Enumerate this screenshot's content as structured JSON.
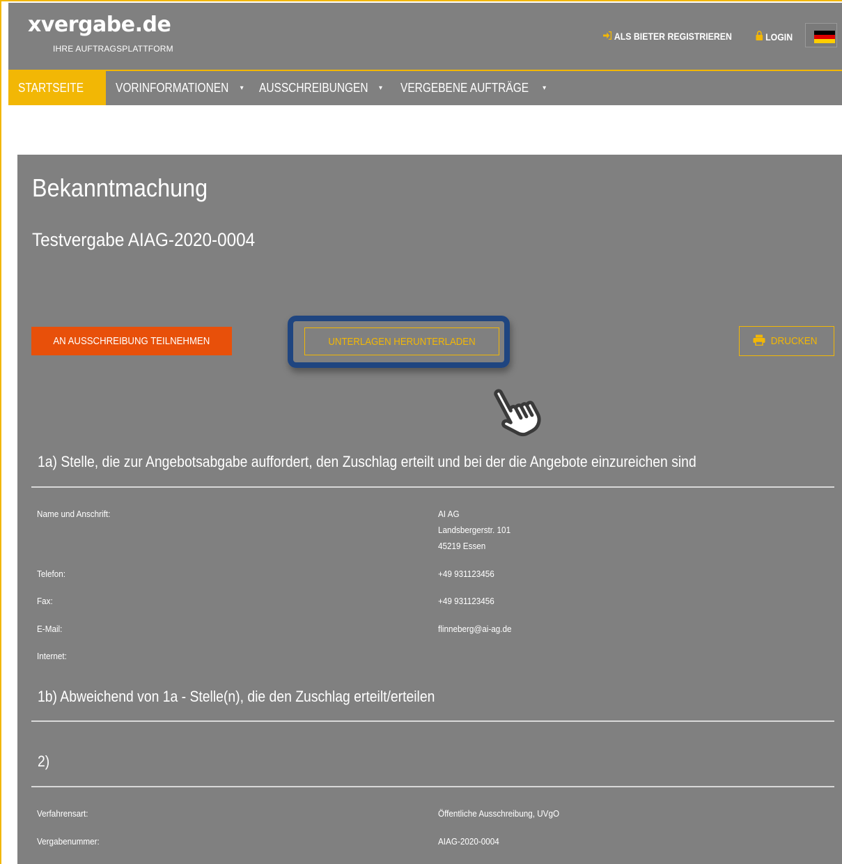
{
  "header": {
    "logo": "xvergabe.de",
    "tagline": "IHRE AUFTRAGSPLATTFORM",
    "register_label": "ALS BIETER REGISTRIEREN",
    "login_label": "LOGIN",
    "language": "de",
    "colors": {
      "accent": "#f2b705",
      "bar": "#808080"
    }
  },
  "nav": {
    "items": [
      {
        "label": "STARTSEITE",
        "active": true
      },
      {
        "label": "VORINFORMATIONEN"
      },
      {
        "label": "AUSSCHREIBUNGEN"
      },
      {
        "label": "VERGEBENE AUFTRÄGE"
      }
    ]
  },
  "main": {
    "title": "Bekanntmachung",
    "subtitle": "Testvergabe AIAG-2020-0004",
    "buttons": {
      "participate": "AN AUSSCHREIBUNG TEILNEHMEN",
      "download": "UNTERLAGEN HERUNTERLADEN",
      "print": "DRUCKEN"
    },
    "section_1a": {
      "title": "1a) Stelle, die zur Angebotsabgabe auffordert, den Zuschlag erteilt und bei der die Angebote einzureichen sind",
      "name_label": "Name und Anschrift:",
      "name_lines": [
        "AI AG",
        "Landsbergerstr. 101",
        "45219 Essen"
      ],
      "phone_label": "Telefon:",
      "phone": "+49 931123456",
      "fax_label": "Fax:",
      "fax": "+49 931123456",
      "email_label": "E-Mail:",
      "email": "flinneberg@ai-ag.de",
      "internet_label": "Internet:"
    },
    "section_1b": {
      "title": "1b) Abweichend von 1a - Stelle(n), die den Zuschlag erteilt/erteilen"
    },
    "section_2": {
      "title": "2)",
      "procedure_label": "Verfahrensart:",
      "procedure": "Öffentliche Ausschreibung, UVgO",
      "number_label": "Vergabenummer:",
      "number": "AIAG-2020-0004"
    }
  }
}
